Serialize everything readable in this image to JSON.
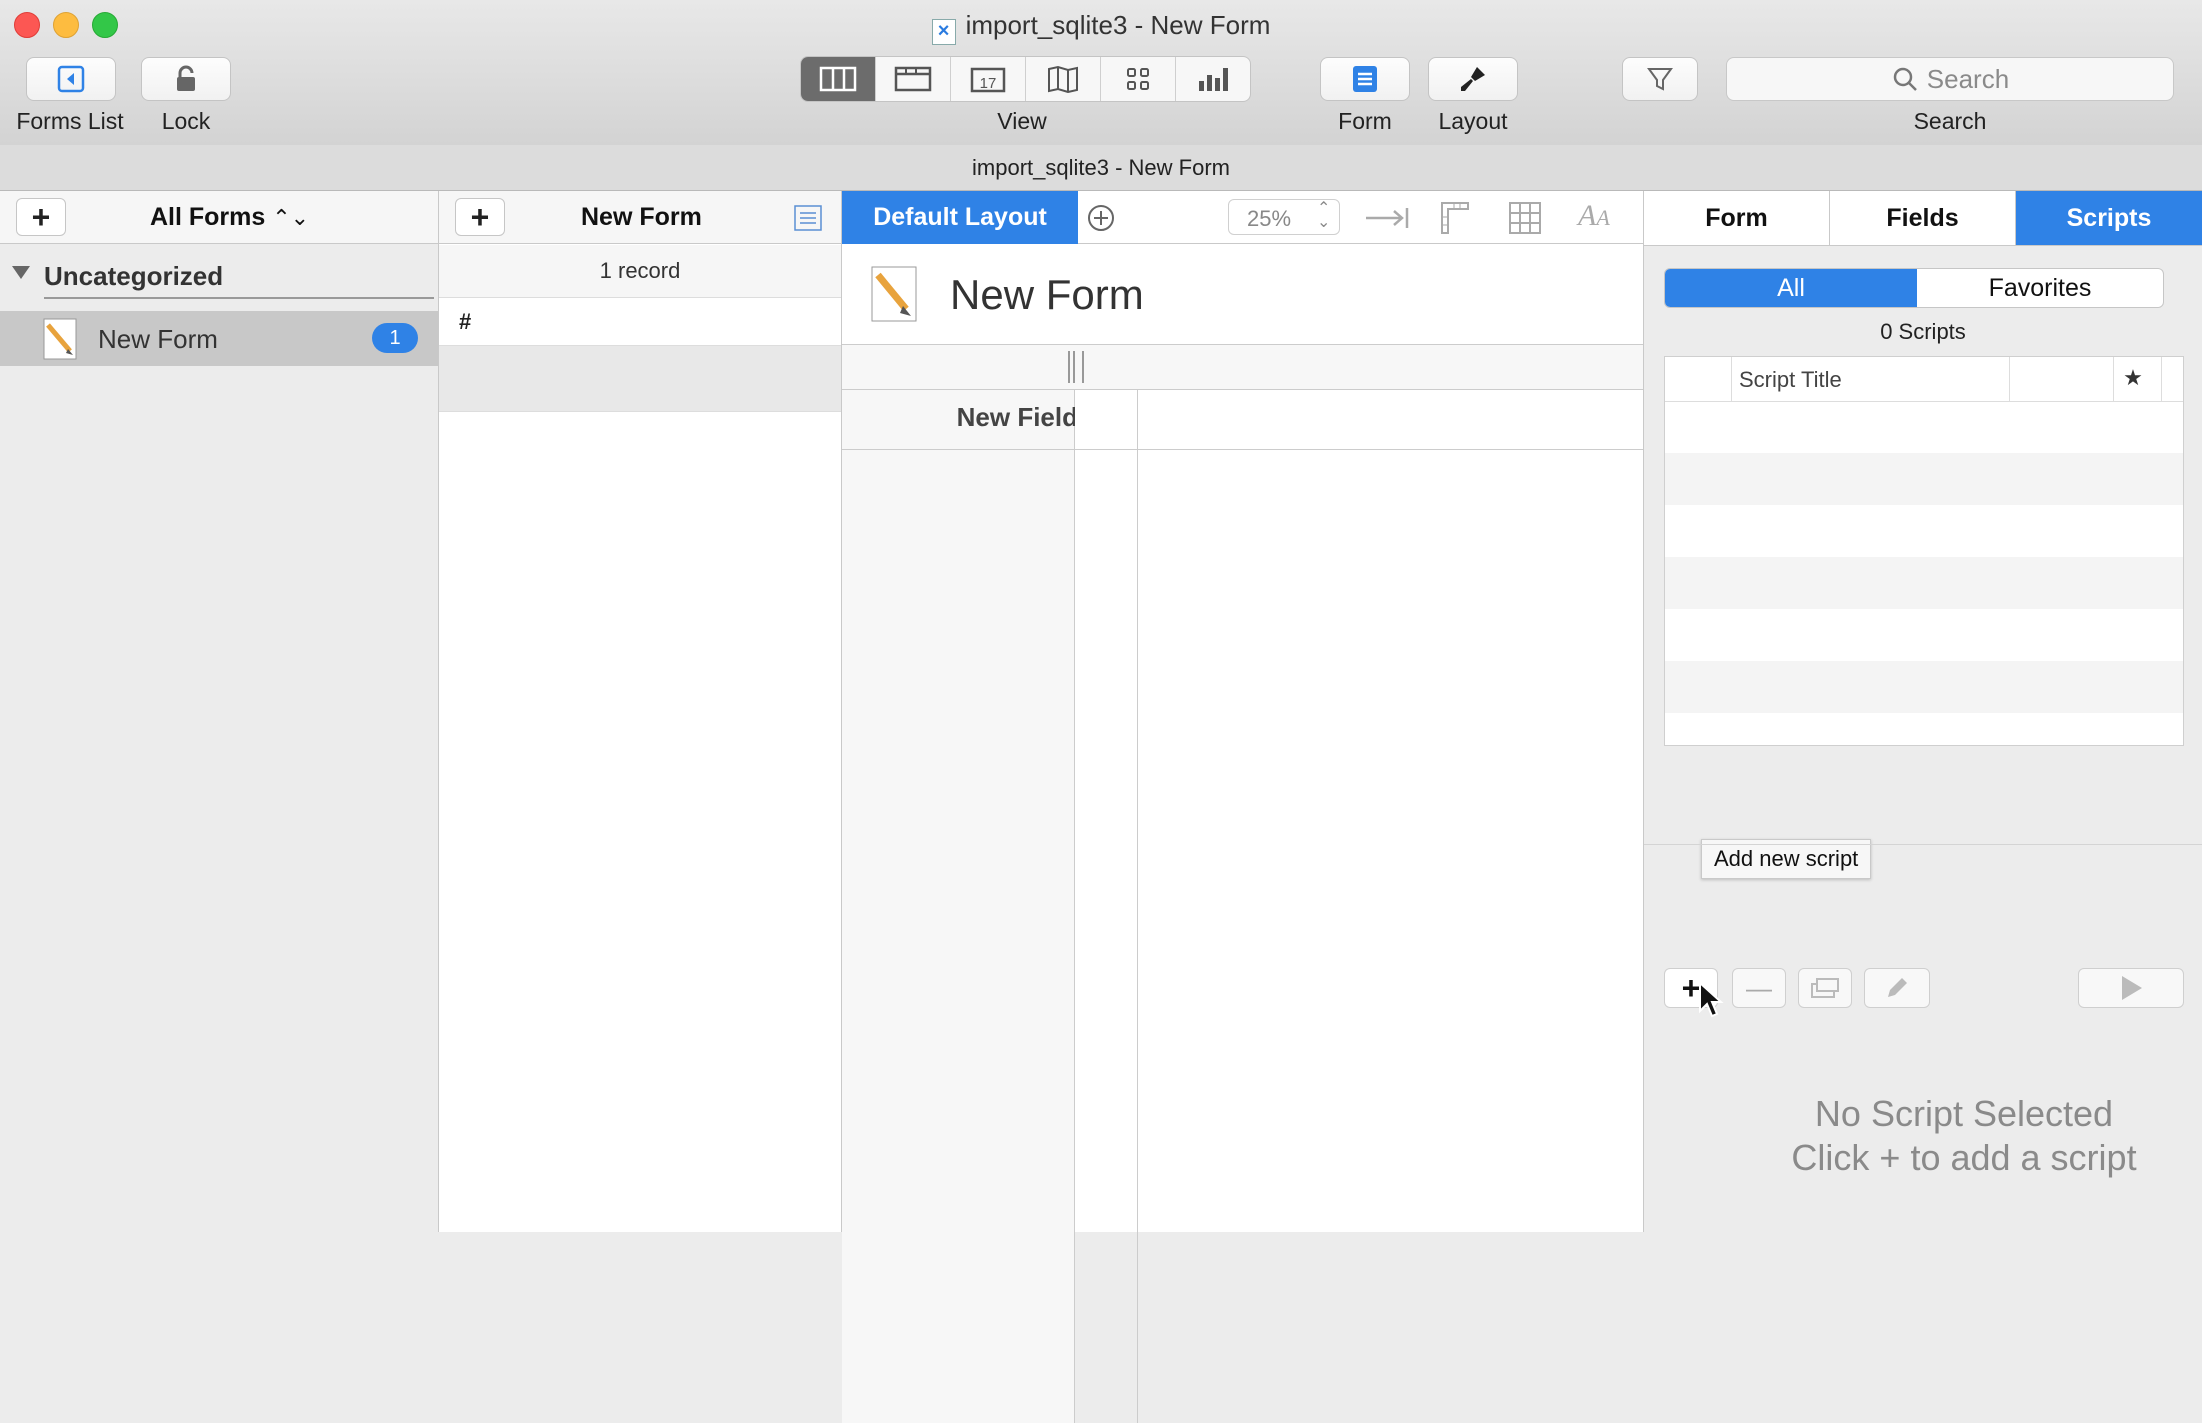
{
  "window": {
    "title": "import_sqlite3 - New Form",
    "subtitle": "import_sqlite3 - New Form"
  },
  "toolbar": {
    "forms_list_label": "Forms List",
    "lock_label": "Lock",
    "view_label": "View",
    "form_label": "Form",
    "layout_label": "Layout",
    "search_label": "Search",
    "search_placeholder": "Search",
    "view_modes": [
      "columns-view-icon",
      "layout-view-icon",
      "calendar-view-icon",
      "map-view-icon",
      "grid-view-icon",
      "chart-view-icon"
    ],
    "active_view": "columns-view-icon"
  },
  "forms_panel": {
    "header": "All Forms",
    "group": "Uncategorized",
    "items": [
      {
        "label": "New Form",
        "count": "1"
      }
    ]
  },
  "records_panel": {
    "header": "New Form",
    "record_count": "1 record",
    "column_header": "#"
  },
  "layout_panel": {
    "layout_tab": "Default Layout",
    "zoom": "25%",
    "form_title": "New Form",
    "field_label": "New Field"
  },
  "inspector": {
    "tabs": [
      "Form",
      "Fields",
      "Scripts"
    ],
    "active_tab": "Scripts",
    "filter_all": "All",
    "filter_favorites": "Favorites",
    "script_count": "0 Scripts",
    "column_title": "Script Title",
    "star": "★",
    "tooltip": "Add new script",
    "empty_title": "No Script Selected",
    "empty_hint": "Click + to add a script"
  },
  "colors": {
    "accent": "#2f82e6",
    "selected_row": "#c8c8c8"
  }
}
